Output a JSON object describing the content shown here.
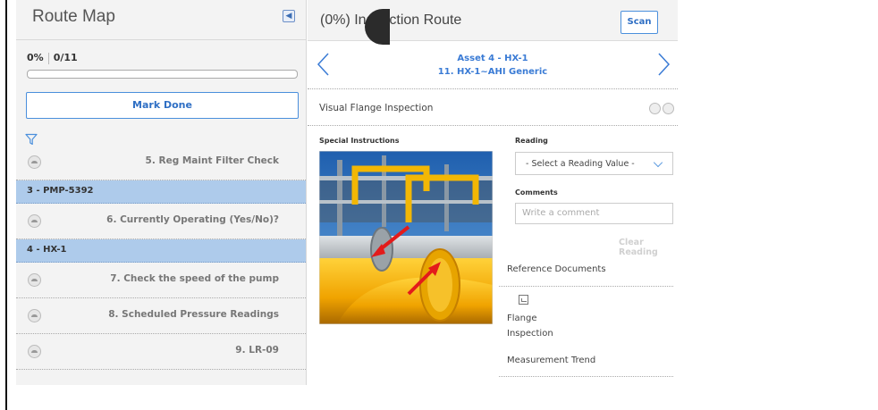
{
  "route_map": {
    "title": "Route Map",
    "collapse_icon": "collapse-left-icon",
    "progress_percent": "0%",
    "progress_count": "0/11",
    "progress_fraction": 0,
    "mark_done_label": "Mark Done",
    "filter_icon": "filter-icon",
    "items": [
      {
        "kind": "step",
        "label": "5. Reg Maint Filter Check"
      },
      {
        "kind": "group",
        "label": "3 - PMP-5392"
      },
      {
        "kind": "step",
        "label": "6. Currently Operating (Yes/No)?"
      },
      {
        "kind": "group",
        "label": "4 - HX-1"
      },
      {
        "kind": "step",
        "label": "7. Check the speed of the pump"
      },
      {
        "kind": "step",
        "label": "8. Scheduled Pressure Readings"
      },
      {
        "kind": "step",
        "label": "9. LR-09"
      }
    ]
  },
  "detail": {
    "title": "(0%) Inspection Route",
    "scan_label": "Scan",
    "asset_line": "Asset 4 - HX-1",
    "step_line": "11. HX-1~AHI Generic",
    "step_title": "Visual Flange Inspection",
    "special_instructions_label": "Special Instructions",
    "reading_label": "Reading",
    "reading_placeholder": "- Select a Reading Value -",
    "comments_label": "Comments",
    "comment_placeholder": "Write a comment",
    "clear_reading_label": "Clear Reading",
    "reference_documents_label": "Reference Documents",
    "document_name": "Flange Inspection",
    "measurement_trend_label": "Measurement Trend"
  },
  "colors": {
    "accent": "#4a8fdc",
    "group_row": "#aecbeb",
    "panel_bg": "#f3f3f3"
  }
}
